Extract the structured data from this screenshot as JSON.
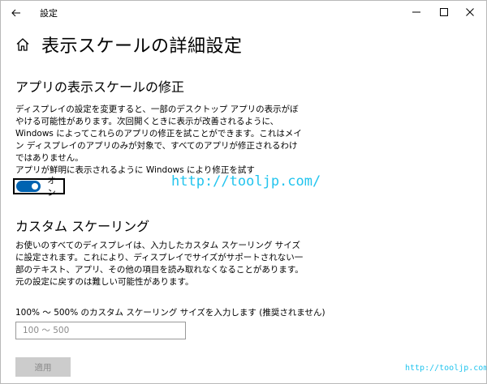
{
  "window": {
    "title": "設定"
  },
  "page": {
    "title": "表示スケールの詳細設定"
  },
  "fix_scaling": {
    "heading": "アプリの表示スケールの修正",
    "description": "ディスプレイの設定を変更すると、一部のデスクトップ アプリの表示がぼやける可能性があります。次回開くときに表示が改善されるように、Windows によってこれらのアプリの修正を試ことができます。これはメイン ディスプレイのアプリのみが対象で、すべてのアプリが修正されるわけではありません。",
    "toggle_label": "アプリが鮮明に表示されるように Windows により修正を試す",
    "toggle_state": "オン",
    "toggle_on": true
  },
  "custom_scaling": {
    "heading": "カスタム スケーリング",
    "description": "お使いのすべてのディスプレイは、入力したカスタム スケーリング サイズに設定されます。これにより、ディスプレイでサイズがサポートされない一部のテキスト、アプリ、その他の項目を読み取れなくなることがあります。元の設定に戻すのは難しい可能性があります。",
    "input_label": "100% 〜 500% のカスタム スケーリング サイズを入力します (推奨されません)",
    "input_placeholder": "100 〜 500",
    "input_value": "",
    "apply_label": "適用"
  },
  "watermark": {
    "main": "http://tooljp.com/",
    "corner": "http://tooljp.com"
  },
  "colors": {
    "toggle_on": "#0063b1",
    "watermark": "#22c4ee",
    "button_disabled_bg": "#cccccc",
    "button_disabled_text": "#8a8a8a"
  },
  "icons": {
    "back": "back-arrow-icon",
    "home": "home-icon",
    "minimize": "minimize-icon",
    "maximize": "maximize-icon",
    "close": "close-icon"
  }
}
